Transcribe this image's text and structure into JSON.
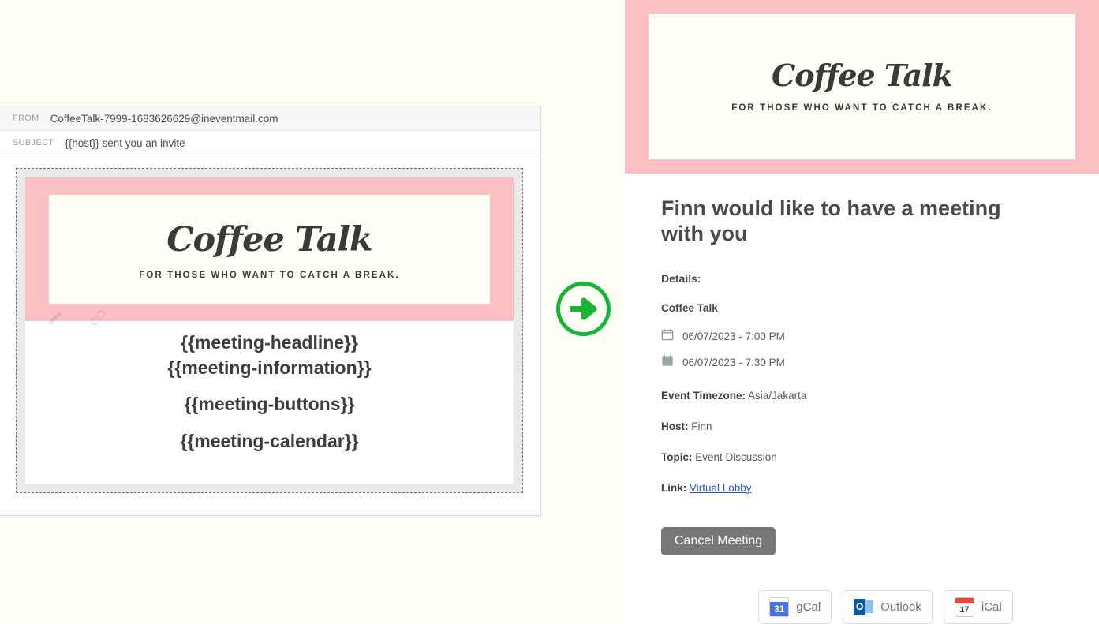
{
  "email_editor": {
    "from_label": "FROM",
    "from_value": "CoffeeTalk-7999-1683626629@ineventmail.com",
    "subject_label": "SUBJECT",
    "subject_value": "{{host}} sent you an invite",
    "banner": {
      "logo": "Coffee Talk",
      "tagline": "For those who want to catch a break."
    },
    "placeholders": [
      "{{meeting-headline}}",
      "{{meeting-information}}",
      "{{meeting-buttons}}",
      "{{meeting-calendar}}"
    ]
  },
  "arrow": {
    "icon": "arrow-right-circle-icon",
    "color": "#17b436"
  },
  "preview": {
    "banner": {
      "logo": "Coffee Talk",
      "tagline": "For those who want to catch a break."
    },
    "headline": "Finn would like to have a meeting with you",
    "details_label": "Details:",
    "event_name": "Coffee Talk",
    "start_time": "06/07/2023 - 7:00 PM",
    "end_time": "06/07/2023 - 7:30 PM",
    "timezone_label": "Event Timezone:",
    "timezone_value": "Asia/Jakarta",
    "host_label": "Host:",
    "host_value": "Finn",
    "topic_label": "Topic:",
    "topic_value": "Event Discussion",
    "link_label": "Link:",
    "link_text": "Virtual Lobby",
    "cancel_button": "Cancel Meeting",
    "calendar_buttons": [
      {
        "label": "gCal",
        "day": "31"
      },
      {
        "label": "Outlook",
        "mark": "O"
      },
      {
        "label": "iCal",
        "day": "17"
      }
    ]
  },
  "colors": {
    "banner_pink": "#fbbfc4",
    "banner_cream": "#fffef7",
    "page_background": "#fdfef5",
    "accent_green": "#17b436",
    "link_blue": "#2b54c6",
    "cancel_gray": "#777777"
  }
}
